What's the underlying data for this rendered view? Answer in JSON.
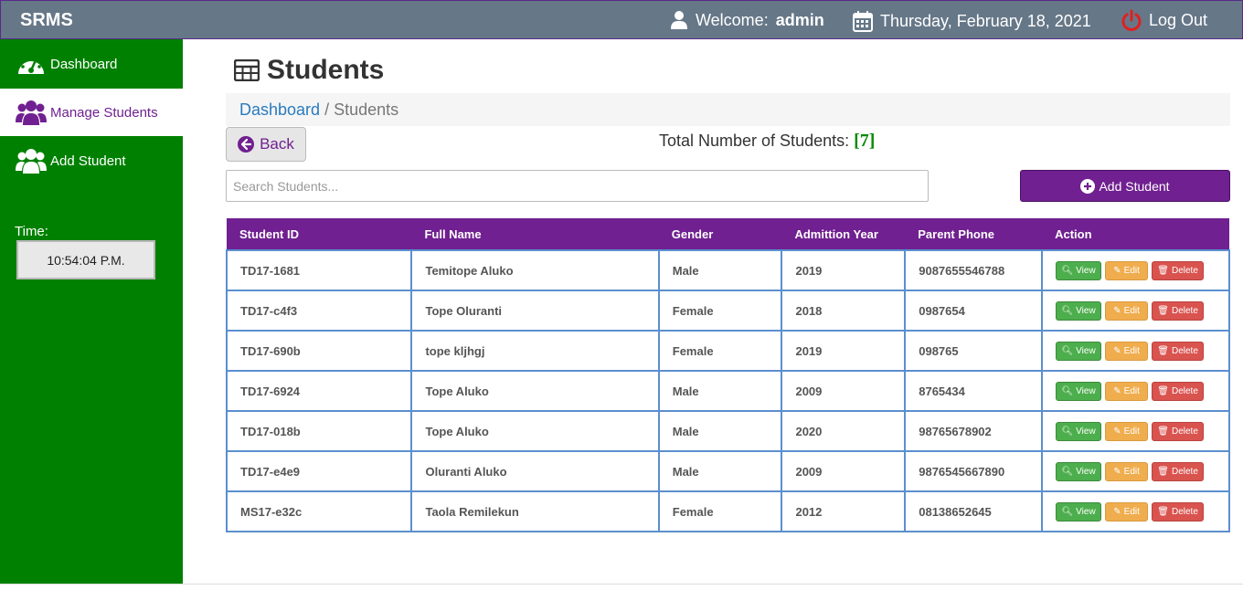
{
  "header": {
    "brand": "SRMS",
    "welcome_prefix": "Welcome:",
    "username": "admin",
    "date": "Thursday, February 18, 2021",
    "logout_label": "Log Out"
  },
  "sidebar": {
    "items": [
      {
        "label": "Dashboard",
        "icon": "dashboard-icon"
      },
      {
        "label": "Manage Students",
        "icon": "users-icon"
      },
      {
        "label": "Add Student",
        "icon": "users-icon"
      }
    ],
    "time_label": "Time:",
    "clock": "10:54:04 P.M."
  },
  "main": {
    "title": "Students",
    "breadcrumb": {
      "home": "Dashboard",
      "separator": "/",
      "current": "Students"
    },
    "back_label": "Back",
    "total_label": "Total Number of Students:",
    "total_count": "[7]",
    "search_placeholder": "Search Students...",
    "add_label": "Add Student"
  },
  "table": {
    "columns": [
      "Student ID",
      "Full Name",
      "Gender",
      "Admittion Year",
      "Parent Phone",
      "Action"
    ],
    "rows": [
      [
        "TD17-1681",
        "Temitope Aluko",
        "Male",
        "2019",
        "9087655546788"
      ],
      [
        "TD17-c4f3",
        "Tope Oluranti",
        "Female",
        "2018",
        "0987654"
      ],
      [
        "TD17-690b",
        "tope kljhgj",
        "Female",
        "2019",
        "098765"
      ],
      [
        "TD17-6924",
        "Tope Aluko",
        "Male",
        "2009",
        "8765434"
      ],
      [
        "TD17-018b",
        "Tope Aluko",
        "Male",
        "2020",
        "98765678902"
      ],
      [
        "TD17-e4e9",
        "Oluranti Aluko",
        "Male",
        "2009",
        "9876545667890"
      ],
      [
        "MS17-e32c",
        "Taola Remilekun",
        "Female",
        "2012",
        "08138652645"
      ]
    ],
    "actions": {
      "view": "View",
      "edit": "Edit",
      "delete": "Delete"
    }
  },
  "colors": {
    "topbar": "#667788",
    "sidebar": "#008000",
    "accent": "#702090",
    "view": "#4cae4c",
    "edit": "#f0ad4e",
    "delete": "#d9534f"
  }
}
